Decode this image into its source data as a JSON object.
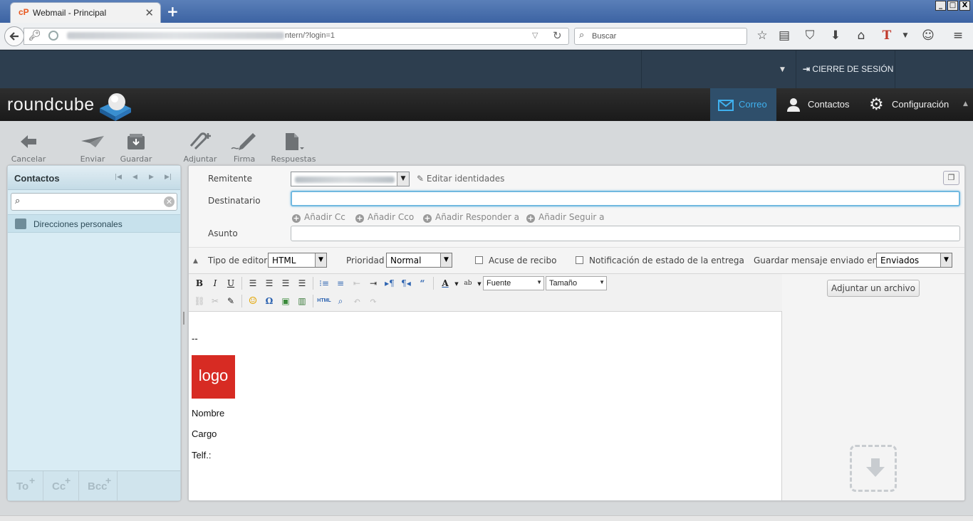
{
  "browser": {
    "tab_title": "Webmail - Principal",
    "tab_icon": "cP",
    "new_tab": "+",
    "url_visible": "ntern/?login=1",
    "search_placeholder": "Buscar",
    "window_controls": [
      "_",
      "□",
      "X"
    ]
  },
  "topbar": {
    "logout_label": "CIERRE DE SESIÓN"
  },
  "header": {
    "logo_text": "roundcube",
    "nav": [
      {
        "label": "Correo",
        "active": true
      },
      {
        "label": "Contactos",
        "active": false
      },
      {
        "label": "Configuración",
        "active": false
      }
    ]
  },
  "toolbar": {
    "buttons": [
      {
        "label": "Cancelar",
        "icon": "arrow-left-icon"
      },
      {
        "label": "Enviar",
        "icon": "paper-plane-icon"
      },
      {
        "label": "Guardar",
        "icon": "save-box-icon"
      },
      {
        "label": "Adjuntar",
        "icon": "paperclip-icon"
      },
      {
        "label": "Firma",
        "icon": "pen-icon"
      },
      {
        "label": "Respuestas",
        "icon": "document-icon"
      }
    ]
  },
  "contacts_panel": {
    "title": "Contactos",
    "address_book": "Direcciones personales",
    "footer": [
      {
        "label": "To",
        "plus": "+"
      },
      {
        "label": "Cc",
        "plus": "+"
      },
      {
        "label": "Bcc",
        "plus": "+"
      }
    ]
  },
  "compose": {
    "sender_label": "Remitente",
    "edit_identities": "Editar identidades",
    "recipient_label": "Destinatario",
    "recipient_value": "",
    "add_links": [
      "Añadir Cc",
      "Añadir Cco",
      "Añadir Responder a",
      "Añadir Seguir a"
    ],
    "subject_label": "Asunto",
    "subject_value": "",
    "editor_type_label": "Tipo de editor",
    "editor_type_value": "HTML",
    "priority_label": "Prioridad",
    "priority_value": "Normal",
    "receipt_label": "Acuse de recibo",
    "dsn_label": "Notificación de estado de la entrega",
    "save_sent_label": "Guardar mensaje enviado en",
    "save_sent_value": "Enviados"
  },
  "editor": {
    "font_select": "Fuente",
    "size_select": "Tamaño",
    "html_button": "HTML"
  },
  "signature": {
    "dashes": "--",
    "logo": "logo",
    "name": "Nombre",
    "position": "Cargo",
    "phone": "Telf.:"
  },
  "attachments": {
    "button_label": "Adjuntar un archivo"
  },
  "colors": {
    "topbar": "#2d3e4f",
    "header": "#1f1f1f",
    "active_nav": "#3fb0ee",
    "panel": "#d9ecf4",
    "logo_red": "#d72b23"
  }
}
